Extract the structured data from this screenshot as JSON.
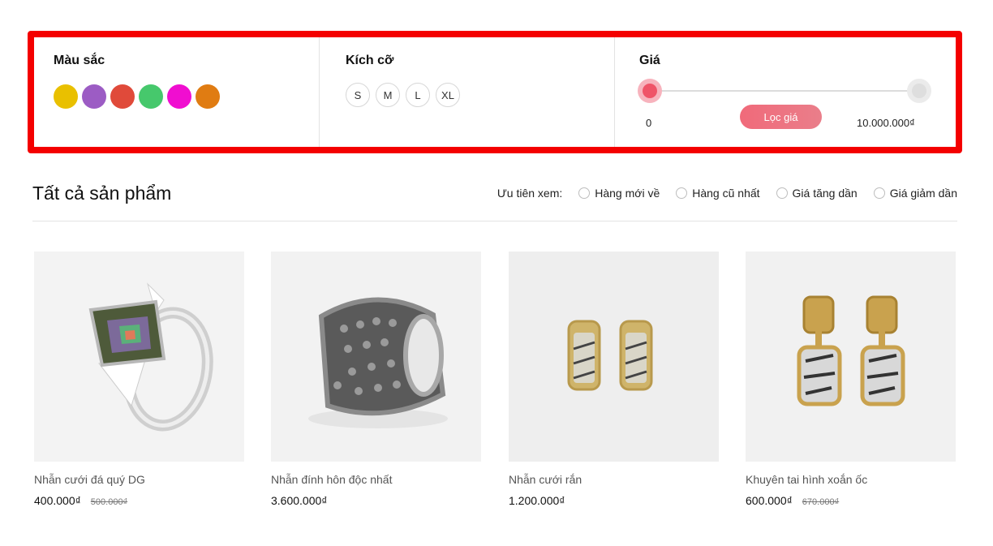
{
  "filters": {
    "color": {
      "title": "Màu sắc",
      "swatches": [
        {
          "name": "yellow",
          "hex": "#e9c000"
        },
        {
          "name": "purple",
          "hex": "#9c5cc4"
        },
        {
          "name": "red",
          "hex": "#e04a3a"
        },
        {
          "name": "green",
          "hex": "#46c86c"
        },
        {
          "name": "magenta",
          "hex": "#f00ed0"
        },
        {
          "name": "orange",
          "hex": "#e07c12"
        }
      ]
    },
    "size": {
      "title": "Kích cỡ",
      "options": [
        "S",
        "M",
        "L",
        "XL"
      ]
    },
    "price": {
      "title": "Giá",
      "min_label": "0",
      "max_label": "10.000.000₫",
      "button_label": "Lọc giá"
    }
  },
  "section": {
    "title": "Tất cả sản phẩm",
    "sort_label": "Ưu tiên xem:",
    "sort_options": [
      "Hàng mới về",
      "Hàng cũ nhất",
      "Giá tăng dần",
      "Giá giảm dần"
    ]
  },
  "products": [
    {
      "name": "Nhẫn cưới đá quý DG",
      "price": "400.000₫",
      "old_price": "500.000₫"
    },
    {
      "name": "Nhẫn đính hôn độc nhất",
      "price": "3.600.000₫",
      "old_price": ""
    },
    {
      "name": "Nhẫn cưới rắn",
      "price": "1.200.000₫",
      "old_price": ""
    },
    {
      "name": "Khuyên tai hình xoắn ốc",
      "price": "600.000₫",
      "old_price": "670.000₫"
    }
  ],
  "colors": {
    "accent": "#ef5468",
    "border_highlight": "#f40000"
  }
}
